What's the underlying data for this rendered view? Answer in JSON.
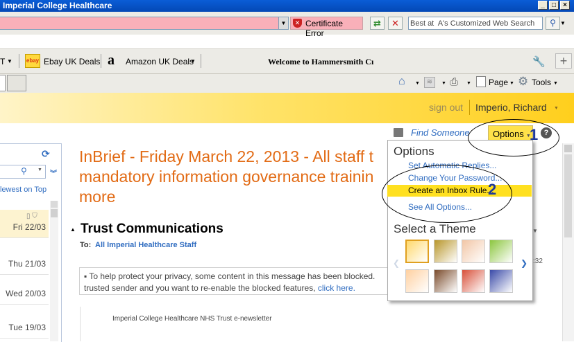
{
  "window": {
    "title": "Imperial College Healthcare"
  },
  "window_buttons": [
    "_",
    "□",
    "×"
  ],
  "addressbar": {
    "certificate_label": "Certificate Error",
    "search_placeholder": "Best at  A's Customized Web Search"
  },
  "favorites": {
    "cut_item": "T",
    "ebay_label": "Ebay UK Deals",
    "ebay_icon_text": "ebay",
    "amazon_label": "Amazon UK Deals",
    "amazon_icon_text": "a",
    "welcome_title": "Welcome to Hammersmith Cı"
  },
  "command_bar": {
    "page_label": "Page",
    "tools_label": "Tools"
  },
  "owa_header": {
    "sign_out": "sign out",
    "user_name": "Imperio, Richard"
  },
  "left_pane": {
    "sort_label": "lewest on Top",
    "messages": [
      {
        "date": "Fri 22/03"
      },
      {
        "date": "Thu 21/03"
      },
      {
        "date": "Wed 20/03"
      },
      {
        "date": "Tue 19/03"
      }
    ]
  },
  "message": {
    "subject_lines": [
      "InBrief - Friday March 22, 2013 - All staff t",
      "mandatory information governance trainin",
      "more"
    ],
    "sender": "Trust Communications",
    "to_label": "To:",
    "to_value": "All Imperial Healthcare Staff",
    "privacy_line1": "To help protect your privacy, some content in this message has been blocked.",
    "privacy_line2": "trusted sender and you want to re-enable the blocked features, ",
    "privacy_link": "click here.",
    "time_fragment": ":32",
    "newsletter_title": "Imperial College Healthcare NHS Trust e-newsletter"
  },
  "toolbar": {
    "find_someone": "Find Someone",
    "options_label": "Options",
    "help_label": "?"
  },
  "options_menu": {
    "title": "Options",
    "items": [
      {
        "label": "Set Automatic Replies..."
      },
      {
        "label": "Change Your Password..."
      },
      {
        "label": "Create an Inbox Rule..."
      },
      {
        "label": "See All Options..."
      }
    ],
    "theme_title": "Select a Theme",
    "themes": [
      {
        "name": "sunny",
        "color": "#ffd86b"
      },
      {
        "name": "bees",
        "color": "#b8962a"
      },
      {
        "name": "peach-sketch",
        "color": "#f2c6a6"
      },
      {
        "name": "green-leaf",
        "color": "#8cc63f"
      },
      {
        "name": "blossom",
        "color": "#ffd0a0"
      },
      {
        "name": "robot",
        "color": "#7a4a2a"
      },
      {
        "name": "red-doodle",
        "color": "#d8503a"
      },
      {
        "name": "monster",
        "color": "#3a4aa8"
      }
    ]
  },
  "annotations": {
    "one": "1",
    "two": "2"
  },
  "colors": {
    "accent": "#2f6cc0",
    "subject": "#e26b15",
    "highlight": "#ffe020",
    "header": "#ffcf1d"
  }
}
